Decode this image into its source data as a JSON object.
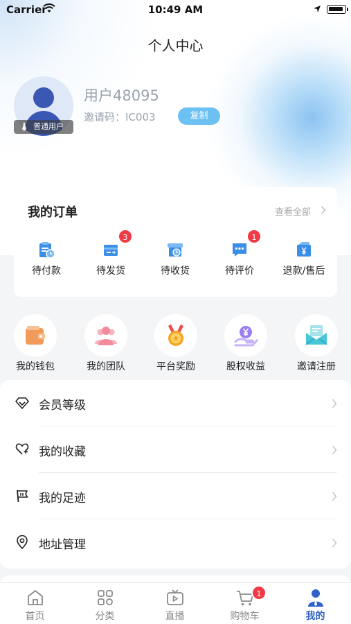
{
  "status_bar": {
    "carrier": "Carrier",
    "time": "10:49 AM"
  },
  "header": {
    "title": "个人中心"
  },
  "profile": {
    "username": "用户48095",
    "invite_label": "邀请码：",
    "invite_code": "IC003",
    "copy_label": "复制",
    "level": "普通用户"
  },
  "orders": {
    "title": "我的订单",
    "view_all": "查看全部",
    "items": [
      {
        "label": "待付款",
        "badge": "",
        "icon": "wallet-clock-icon"
      },
      {
        "label": "待发货",
        "badge": "3",
        "icon": "card-ship-icon"
      },
      {
        "label": "待收货",
        "badge": "",
        "icon": "box-clock-icon"
      },
      {
        "label": "待评价",
        "badge": "1",
        "icon": "chat-bubble-icon"
      },
      {
        "label": "退款/售后",
        "badge": "",
        "icon": "yen-refund-icon"
      }
    ]
  },
  "tools": [
    {
      "label": "我的钱包",
      "icon": "wallet-icon",
      "color": "#f29a5a"
    },
    {
      "label": "我的团队",
      "icon": "team-icon",
      "color": "#f28b9a"
    },
    {
      "label": "平台奖励",
      "icon": "medal-icon",
      "color": "#f5a623"
    },
    {
      "label": "股权收益",
      "icon": "yen-hand-icon",
      "color": "#9a7ef0"
    },
    {
      "label": "邀请注册",
      "icon": "envelope-icon",
      "color": "#48c6d8"
    }
  ],
  "menu": [
    {
      "label": "会员等级",
      "icon": "diamond-icon"
    },
    {
      "label": "我的收藏",
      "icon": "heart-icon"
    },
    {
      "label": "我的足迹",
      "icon": "flag-icon"
    },
    {
      "label": "地址管理",
      "icon": "location-icon"
    }
  ],
  "tabbar": [
    {
      "label": "首页",
      "icon": "home-icon",
      "badge": ""
    },
    {
      "label": "分类",
      "icon": "grid-icon",
      "badge": ""
    },
    {
      "label": "直播",
      "icon": "tv-play-icon",
      "badge": ""
    },
    {
      "label": "购物车",
      "icon": "cart-icon",
      "badge": "1"
    },
    {
      "label": "我的",
      "icon": "user-icon",
      "badge": ""
    }
  ],
  "colors": {
    "accent": "#2f62c8",
    "copy_button": "#6cc0f2",
    "badge": "#f03a46",
    "order_icon": "#3a8ee6"
  }
}
